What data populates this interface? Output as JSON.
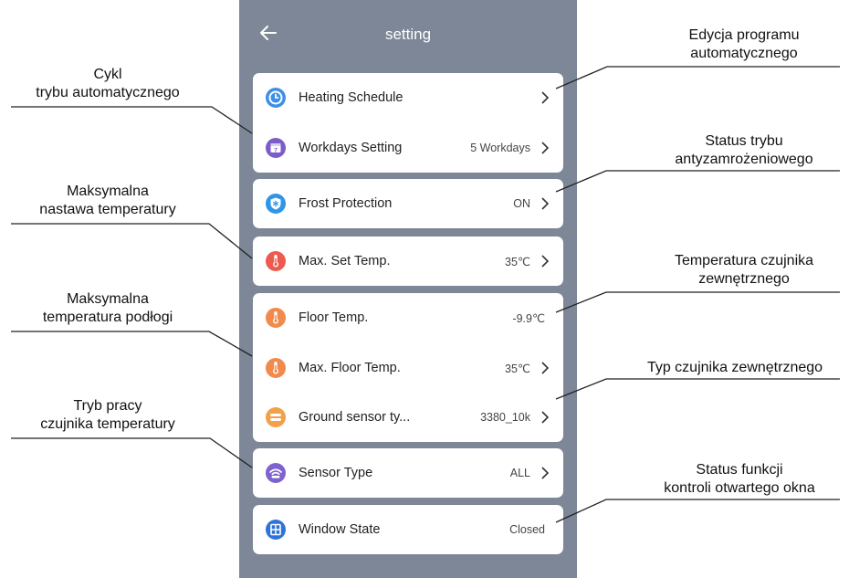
{
  "header": {
    "title": "setting",
    "back_icon": "arrow-left-icon"
  },
  "rows": [
    {
      "label": "Heating Schedule",
      "value": "",
      "icon": "clock-icon",
      "icon_color": "#3d8fe6",
      "arrow": true
    },
    {
      "label": "Workdays Setting",
      "value": "5 Workdays",
      "icon": "calendar-icon",
      "icon_color": "#7b5cc8",
      "arrow": true
    },
    {
      "label": "Frost Protection",
      "value": "ON",
      "icon": "snowflake-shield-icon",
      "icon_color": "#2e95e8",
      "arrow": true
    },
    {
      "label": "Max. Set Temp.",
      "value": "35℃",
      "icon": "thermometer-icon",
      "icon_color": "#ee5a4f",
      "arrow": true
    },
    {
      "label": "Floor Temp.",
      "value": "-9.9℃",
      "icon": "thermometer-icon",
      "icon_color": "#f08a4d",
      "arrow": false
    },
    {
      "label": "Max. Floor Temp.",
      "value": "35℃",
      "icon": "thermometer-icon",
      "icon_color": "#f08a4d",
      "arrow": true
    },
    {
      "label": "Ground sensor ty...",
      "value": "3380_10k",
      "icon": "sensor-icon",
      "icon_color": "#f2a04a",
      "arrow": true
    },
    {
      "label": "Sensor Type",
      "value": "ALL",
      "icon": "wifi-sensor-icon",
      "icon_color": "#7e62cf",
      "arrow": true
    },
    {
      "label": "Window State",
      "value": "Closed",
      "icon": "window-icon",
      "icon_color": "#2f73d9",
      "arrow": false
    }
  ],
  "callouts": {
    "left": [
      {
        "line1": "Cykl",
        "line2": "trybu automatycznego"
      },
      {
        "line1": "Maksymalna",
        "line2": "nastawa temperatury"
      },
      {
        "line1": "Maksymalna",
        "line2": "temperatura podłogi"
      },
      {
        "line1": "Tryb pracy",
        "line2": "czujnika temperatury"
      }
    ],
    "right": [
      {
        "line1": "Edycja programu",
        "line2": "automatycznego"
      },
      {
        "line1": "Status trybu",
        "line2": "antyzamrożeniowego"
      },
      {
        "line1": "Temperatura czujnika",
        "line2": "zewnętrznego"
      },
      {
        "line1": "Typ czujnika zewnętrznego",
        "line2": ""
      },
      {
        "line1": "Status funkcji",
        "line2": "kontroli otwartego okna"
      }
    ]
  }
}
